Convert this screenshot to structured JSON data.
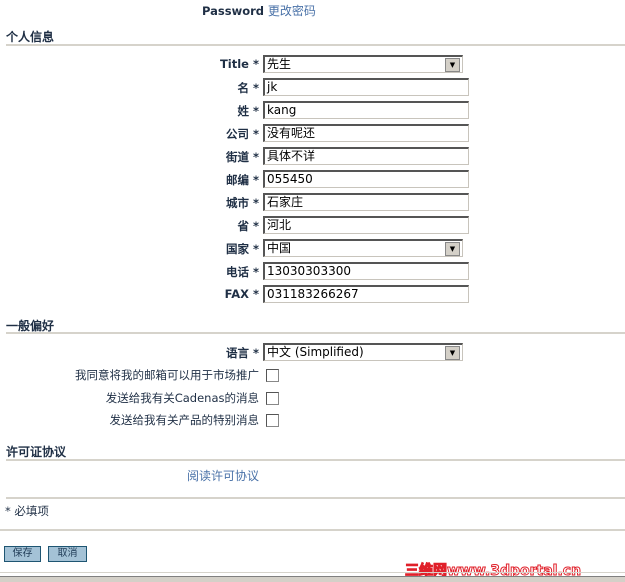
{
  "password": {
    "label": "Password",
    "link": "更改密码"
  },
  "personal": {
    "heading": "个人信息",
    "fields": [
      {
        "label": "Title *",
        "value": "先生",
        "type": "select"
      },
      {
        "label": "名 *",
        "value": "jk"
      },
      {
        "label": "姓 *",
        "value": "kang"
      },
      {
        "label": "公司 *",
        "value": "没有呢还"
      },
      {
        "label": "街道 *",
        "value": "具体不详"
      },
      {
        "label": "邮编 *",
        "value": "055450"
      },
      {
        "label": "城市 *",
        "value": "石家庄"
      },
      {
        "label": "省 *",
        "value": "河北"
      },
      {
        "label": "国家 *",
        "value": "中国",
        "type": "select"
      },
      {
        "label": "电话 *",
        "value": "13030303300"
      },
      {
        "label": "FAX *",
        "value": "031183266267"
      }
    ]
  },
  "prefs": {
    "heading": "一般偏好",
    "language_label": "语言 *",
    "language_value": "中文 (Simplified)",
    "checkboxes": [
      {
        "label": "我同意将我的邮箱可以用于市场推广",
        "checked": false
      },
      {
        "label": "发送给我有关Cadenas的消息",
        "checked": false
      },
      {
        "label": "发送给我有关产品的特别消息",
        "checked": false
      }
    ]
  },
  "license": {
    "heading": "许可证协议",
    "link": "阅读许可协议"
  },
  "required_note": "* 必填项",
  "buttons": {
    "save": "保存",
    "cancel": "取消"
  },
  "watermark": "三维网www.3dportal.cn"
}
